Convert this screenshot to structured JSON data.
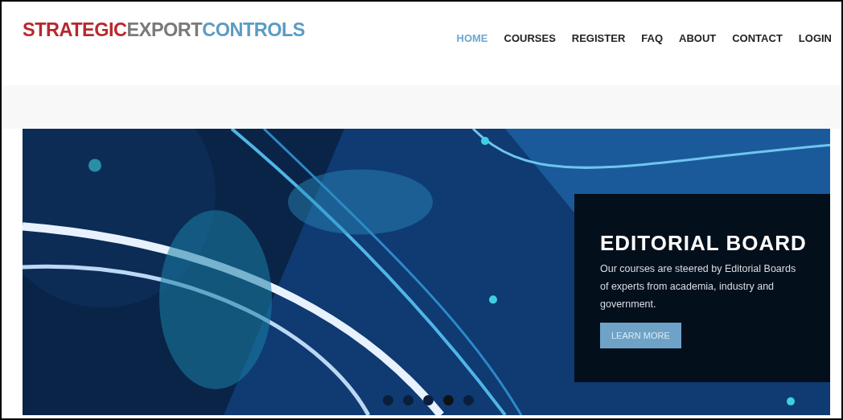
{
  "logo": {
    "parts": [
      {
        "text": "STRATEGIC",
        "color": "#b8282e"
      },
      {
        "text": "EXPORT",
        "color": "#7a7a7a"
      },
      {
        "text": "CONTROLS",
        "color": "#5b9cc4"
      }
    ]
  },
  "nav": [
    {
      "label": "HOME",
      "selected": true
    },
    {
      "label": "COURSES",
      "selected": false
    },
    {
      "label": "REGISTER",
      "selected": false
    },
    {
      "label": "FAQ",
      "selected": false
    },
    {
      "label": "ABOUT",
      "selected": false
    },
    {
      "label": "CONTACT",
      "selected": false
    },
    {
      "label": "LOGIN",
      "selected": false
    }
  ],
  "hero": {
    "kind": "picture",
    "caption": {
      "title": "EDITORIAL BOARD",
      "text": "Our courses are steered by Editorial Boards of experts from academia, industry and government.",
      "button": "LEARN MORE"
    },
    "dots": [
      {
        "selected": false
      },
      {
        "selected": false
      },
      {
        "selected": false
      },
      {
        "selected": true
      },
      {
        "selected": false
      }
    ]
  }
}
